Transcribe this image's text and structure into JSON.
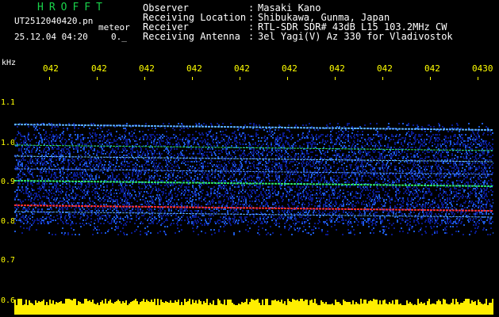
{
  "header": {
    "logo": "HROFFT",
    "filename": "UT2512040420.pn",
    "mode": "meteor",
    "datetime": "25.12.04 04:20",
    "version": "0._"
  },
  "station": {
    "rows": [
      {
        "label": "Observer",
        "value": "Masaki Kano"
      },
      {
        "label": "Receiving Location",
        "value": "Shibukawa, Gunma, Japan"
      },
      {
        "label": "Receiver",
        "value": "RTL-SDR SDR# 43dB L15 103.2MHz CW"
      },
      {
        "label": "Receiving Antenna",
        "value": "3el Yagi(V) Az 330 for Vladivostok"
      }
    ]
  },
  "axis": {
    "unit": "kHz",
    "time_labels": [
      "042",
      "042",
      "042",
      "042",
      "042",
      "042",
      "042",
      "042",
      "042",
      "0430"
    ],
    "freq_labels": [
      "1.1",
      "1.0",
      "0.9",
      "0.8",
      "0.7",
      "0.6"
    ]
  },
  "colors": {
    "background": "#000000",
    "label": "#ffff00",
    "text": "#ffffff",
    "logo": "#19d24a",
    "noise_low": "#0a1a8c",
    "noise_mid": "#1e5adc",
    "line_green": "#2ee86a",
    "line_red": "#ff3030",
    "baseline": "#ffee00"
  }
}
